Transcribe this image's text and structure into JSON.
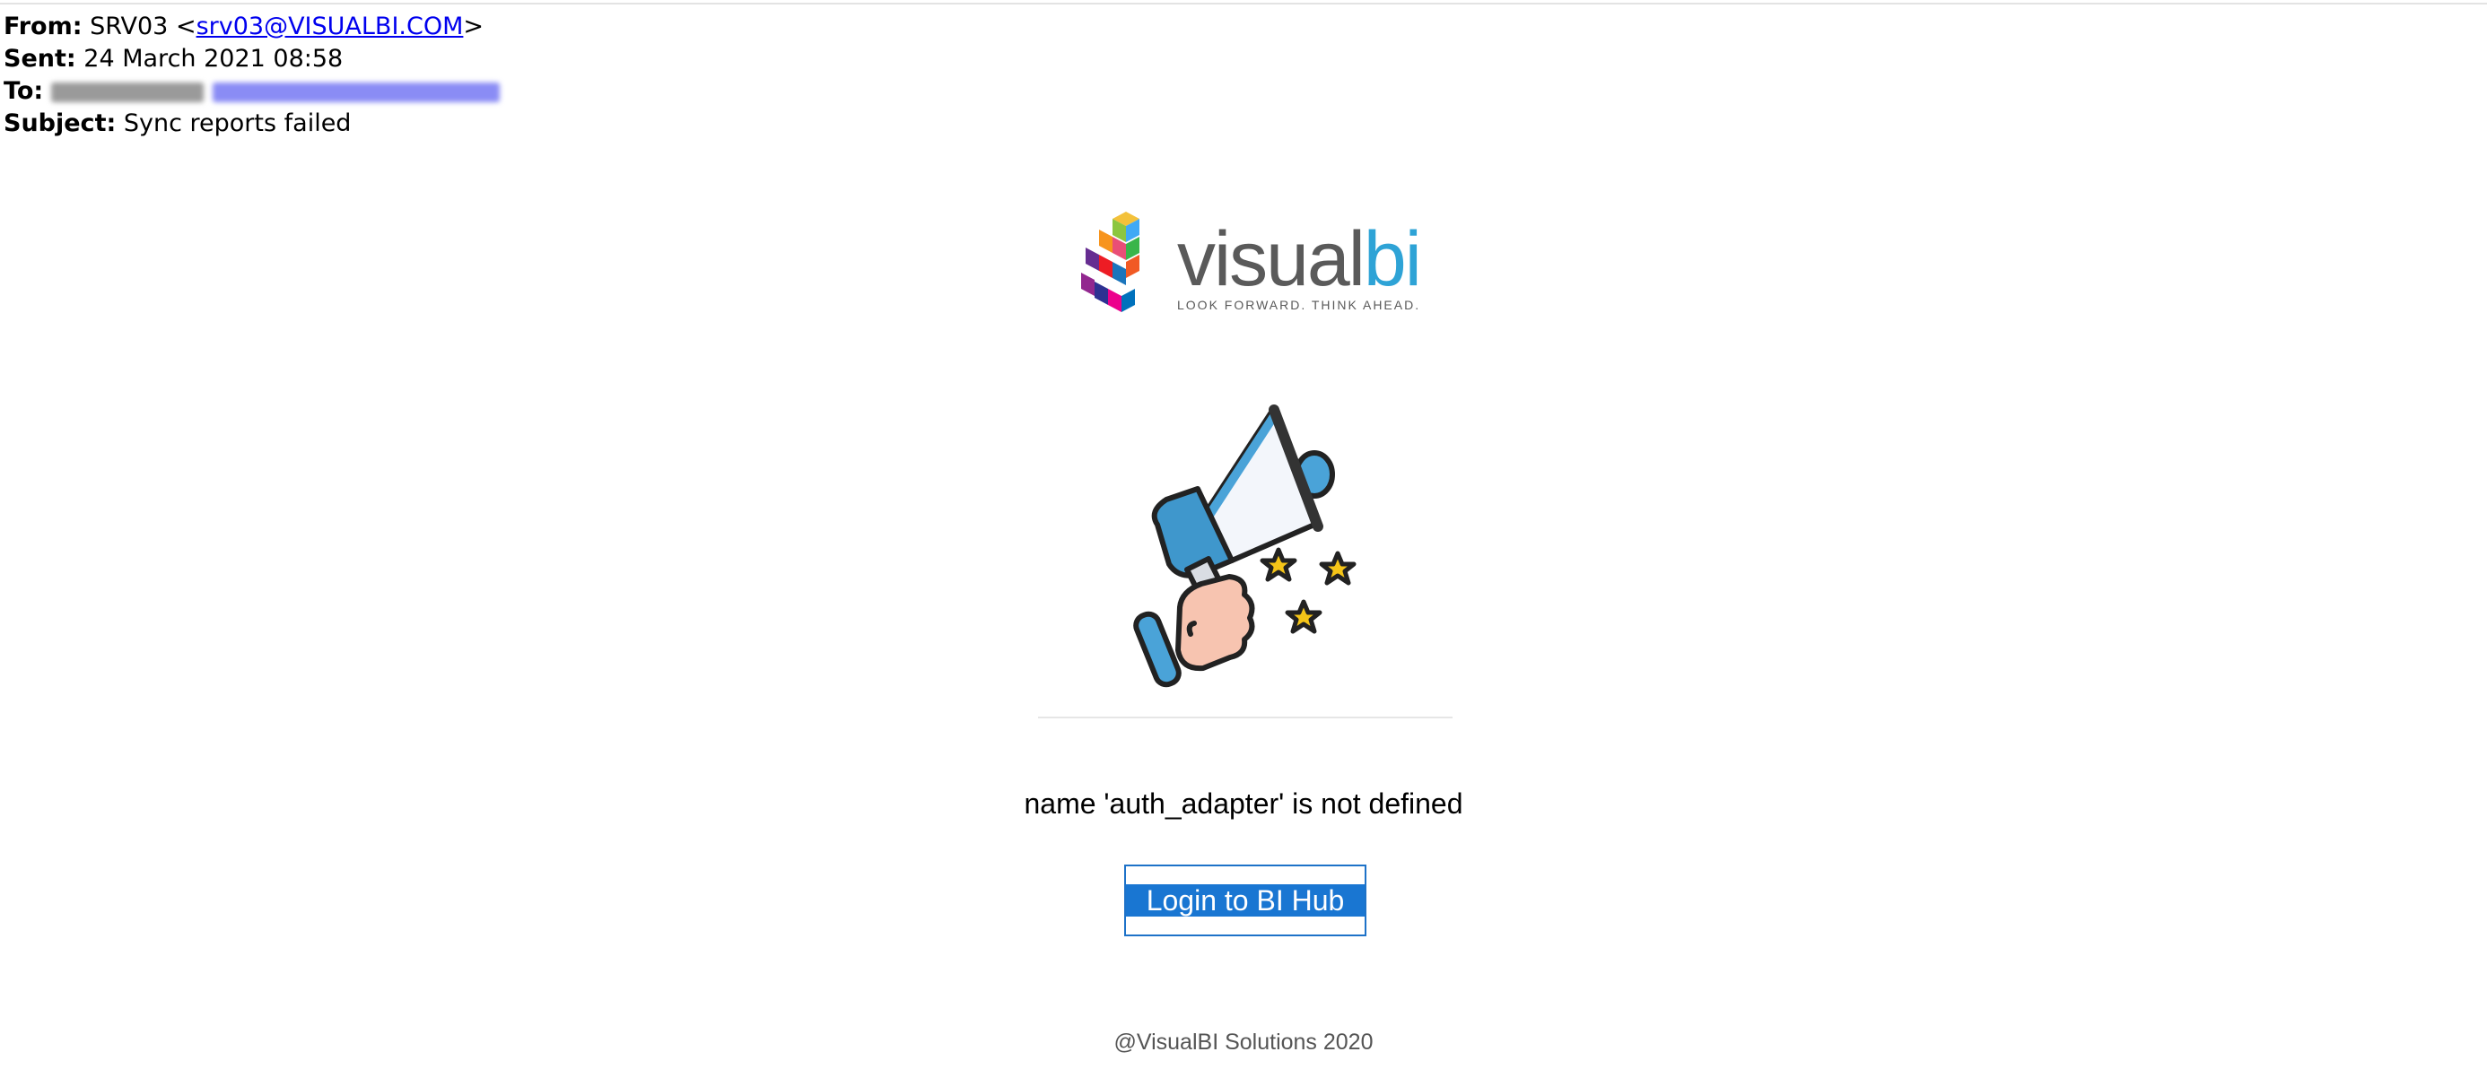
{
  "email": {
    "from_label": "From:",
    "from_name": "SRV03",
    "from_open": "<",
    "from_address": "srv03@VISUALBI.COM",
    "from_close": ">",
    "sent_label": "Sent:",
    "sent_value": "24 March 2021 08:58",
    "to_label": "To:",
    "subject_label": "Subject:",
    "subject_value": "Sync reports failed"
  },
  "logo": {
    "word_visual": "visual",
    "word_bi": "bi",
    "tagline": "LOOK FORWARD. THINK AHEAD."
  },
  "body": {
    "error_message": "name 'auth_adapter' is not defined",
    "login_button_label": "Login to BI Hub",
    "footer": "@VisualBI Solutions 2020"
  },
  "colors": {
    "link": "#0000ee",
    "button_bg": "#1976d2",
    "brand_blue": "#2ea3d6",
    "brand_grey": "#5a5a5a"
  },
  "icons": [
    "visualbi-cube-logo-icon",
    "megaphone-icon",
    "star-icon"
  ]
}
